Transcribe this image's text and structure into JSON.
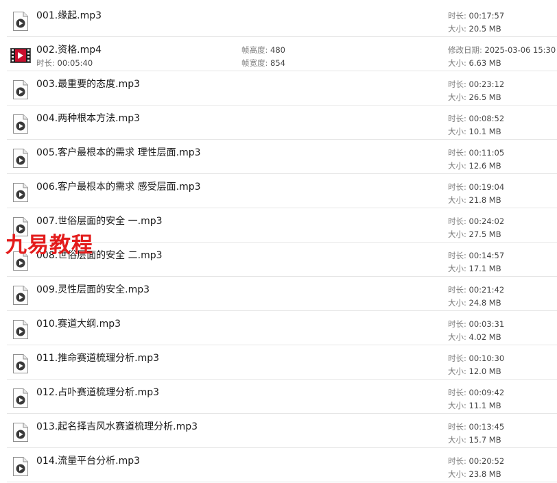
{
  "watermark": "九易教程",
  "labels": {
    "duration": "时长:",
    "size": "大小:",
    "frame_height": "帧高度:",
    "frame_width": "帧宽度:",
    "modified": "修改日期:"
  },
  "files": [
    {
      "name": "001.缘起.mp3",
      "duration": "00:17:57",
      "size": "20.5 MB",
      "icon": "audio-file-icon"
    },
    {
      "name": "002.资格.mp4",
      "duration": "00:05:40",
      "size": "6.63 MB",
      "icon": "video-file-icon",
      "frame_height": "480",
      "frame_width": "854",
      "modified": "2025-03-06 15:30"
    },
    {
      "name": "003.最重要的态度.mp3",
      "duration": "00:23:12",
      "size": "26.5 MB",
      "icon": "audio-file-icon"
    },
    {
      "name": "004.两种根本方法.mp3",
      "duration": "00:08:52",
      "size": "10.1 MB",
      "icon": "audio-file-icon"
    },
    {
      "name": "005.客户最根本的需求 理性层面.mp3",
      "duration": "00:11:05",
      "size": "12.6 MB",
      "icon": "audio-file-icon"
    },
    {
      "name": "006.客户最根本的需求 感受层面.mp3",
      "duration": "00:19:04",
      "size": "21.8 MB",
      "icon": "audio-file-icon"
    },
    {
      "name": "007.世俗层面的安全 一.mp3",
      "duration": "00:24:02",
      "size": "27.5 MB",
      "icon": "audio-file-icon"
    },
    {
      "name": "008.世俗层面的安全 二.mp3",
      "duration": "00:14:57",
      "size": "17.1 MB",
      "icon": "audio-file-icon"
    },
    {
      "name": "009.灵性层面的安全.mp3",
      "duration": "00:21:42",
      "size": "24.8 MB",
      "icon": "audio-file-icon"
    },
    {
      "name": "010.赛道大纲.mp3",
      "duration": "00:03:31",
      "size": "4.02 MB",
      "icon": "audio-file-icon"
    },
    {
      "name": "011.推命赛道梳理分析.mp3",
      "duration": "00:10:30",
      "size": "12.0 MB",
      "icon": "audio-file-icon"
    },
    {
      "name": "012.占卟赛道梳理分析.mp3",
      "duration": "00:09:42",
      "size": "11.1 MB",
      "icon": "audio-file-icon"
    },
    {
      "name": "013.起名择吉风水赛道梳理分析.mp3",
      "duration": "00:13:45",
      "size": "15.7 MB",
      "icon": "audio-file-icon"
    },
    {
      "name": "014.流量平台分析.mp3",
      "duration": "00:20:52",
      "size": "23.8 MB",
      "icon": "audio-file-icon"
    }
  ]
}
